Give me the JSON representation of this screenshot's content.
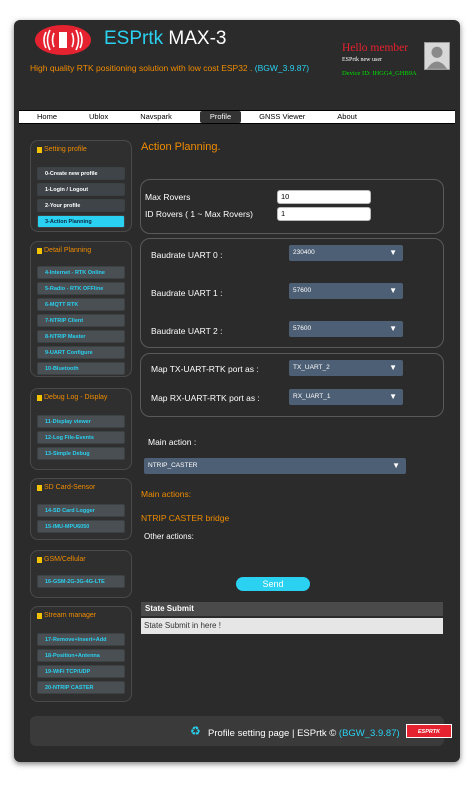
{
  "header": {
    "title_brand": "ESPrtk",
    "title_model": " MAX-3",
    "tagline": "High quality RTK positioning solution with low cost ESP32 . ",
    "tagline_version": "(BGW_3.9.87)",
    "hello": "Hello member",
    "user_sub": "ESPrtk new user",
    "device_id": "Device ID: IHGG4_GHB9A"
  },
  "nav": {
    "items": [
      "Home",
      "Ublox",
      "Navspark",
      "Profile",
      "GNSS Viewer",
      "About"
    ],
    "active": "Profile"
  },
  "sidebar": {
    "setting_profile": {
      "title": "Setting profile",
      "items": [
        "0-Create new profile",
        "1-Login / Logout",
        "2-Your profile",
        "3-Action Planning"
      ]
    },
    "detail_planning": {
      "title": "Detail Planning",
      "items": [
        "4-Internet - RTK Online",
        "5-Radio - RTK OFFline",
        "6-MQTT RTK",
        "7-NTRIP Client",
        "8-NTRIP Master",
        "9-UART Configure",
        "10-Bluetooth"
      ]
    },
    "debug_log": {
      "title": "Debug Log - Display",
      "items": [
        "11-Display viewer",
        "12-Log File-Events",
        "13-Simple Debug"
      ]
    },
    "sd_card": {
      "title": "SD Card-Sensor",
      "items": [
        "14-SD Card Logger",
        "15-IMU-MPU6050"
      ]
    },
    "gsm": {
      "title": "GSM/Cellular",
      "items": [
        "16-GSM-2G-3G-4G-LTE"
      ]
    },
    "stream": {
      "title": "Stream manager",
      "items": [
        "17-Remove+Insert+Add",
        "18-Position+Antenna",
        "19-WiFi TCP/UDP",
        "20-NTRIP CASTER"
      ]
    }
  },
  "main": {
    "title": "Action Planning.",
    "max_rovers_label": "Max Rovers",
    "max_rovers_value": "10",
    "id_rovers_label": "ID Rovers ( 1 ~ Max Rovers)",
    "id_rovers_value": "1",
    "uart0_label": "Baudrate UART 0 :",
    "uart0_value": "230400",
    "uart1_label": "Baudrate UART 1 :",
    "uart1_value": "57600",
    "uart2_label": "Baudrate UART 2 :",
    "uart2_value": "57600",
    "tx_label": "Map TX-UART-RTK port as :",
    "tx_value": "TX_UART_2",
    "rx_label": "Map RX-UART-RTK port as :",
    "rx_value": "RX_UART_1",
    "main_action_label": "Main action :",
    "main_action_value": "NTRIP_CASTER",
    "main_actions_heading": "Main actions:",
    "main_actions_text": "NTRIP CASTER bridge",
    "other_actions_label": "Other actions:",
    "send_label": "Send",
    "state_head": "State Submit",
    "state_body": "State Submit in here !"
  },
  "footer": {
    "text": "Profile setting page | ESPrtk © ",
    "version": "(BGW_3.9.87)",
    "badge": "ESPRTK"
  },
  "colors": {
    "accent": "#2ad1f0",
    "orange": "#f08c00",
    "red": "#e5222f",
    "background": "#2b2b2b"
  }
}
